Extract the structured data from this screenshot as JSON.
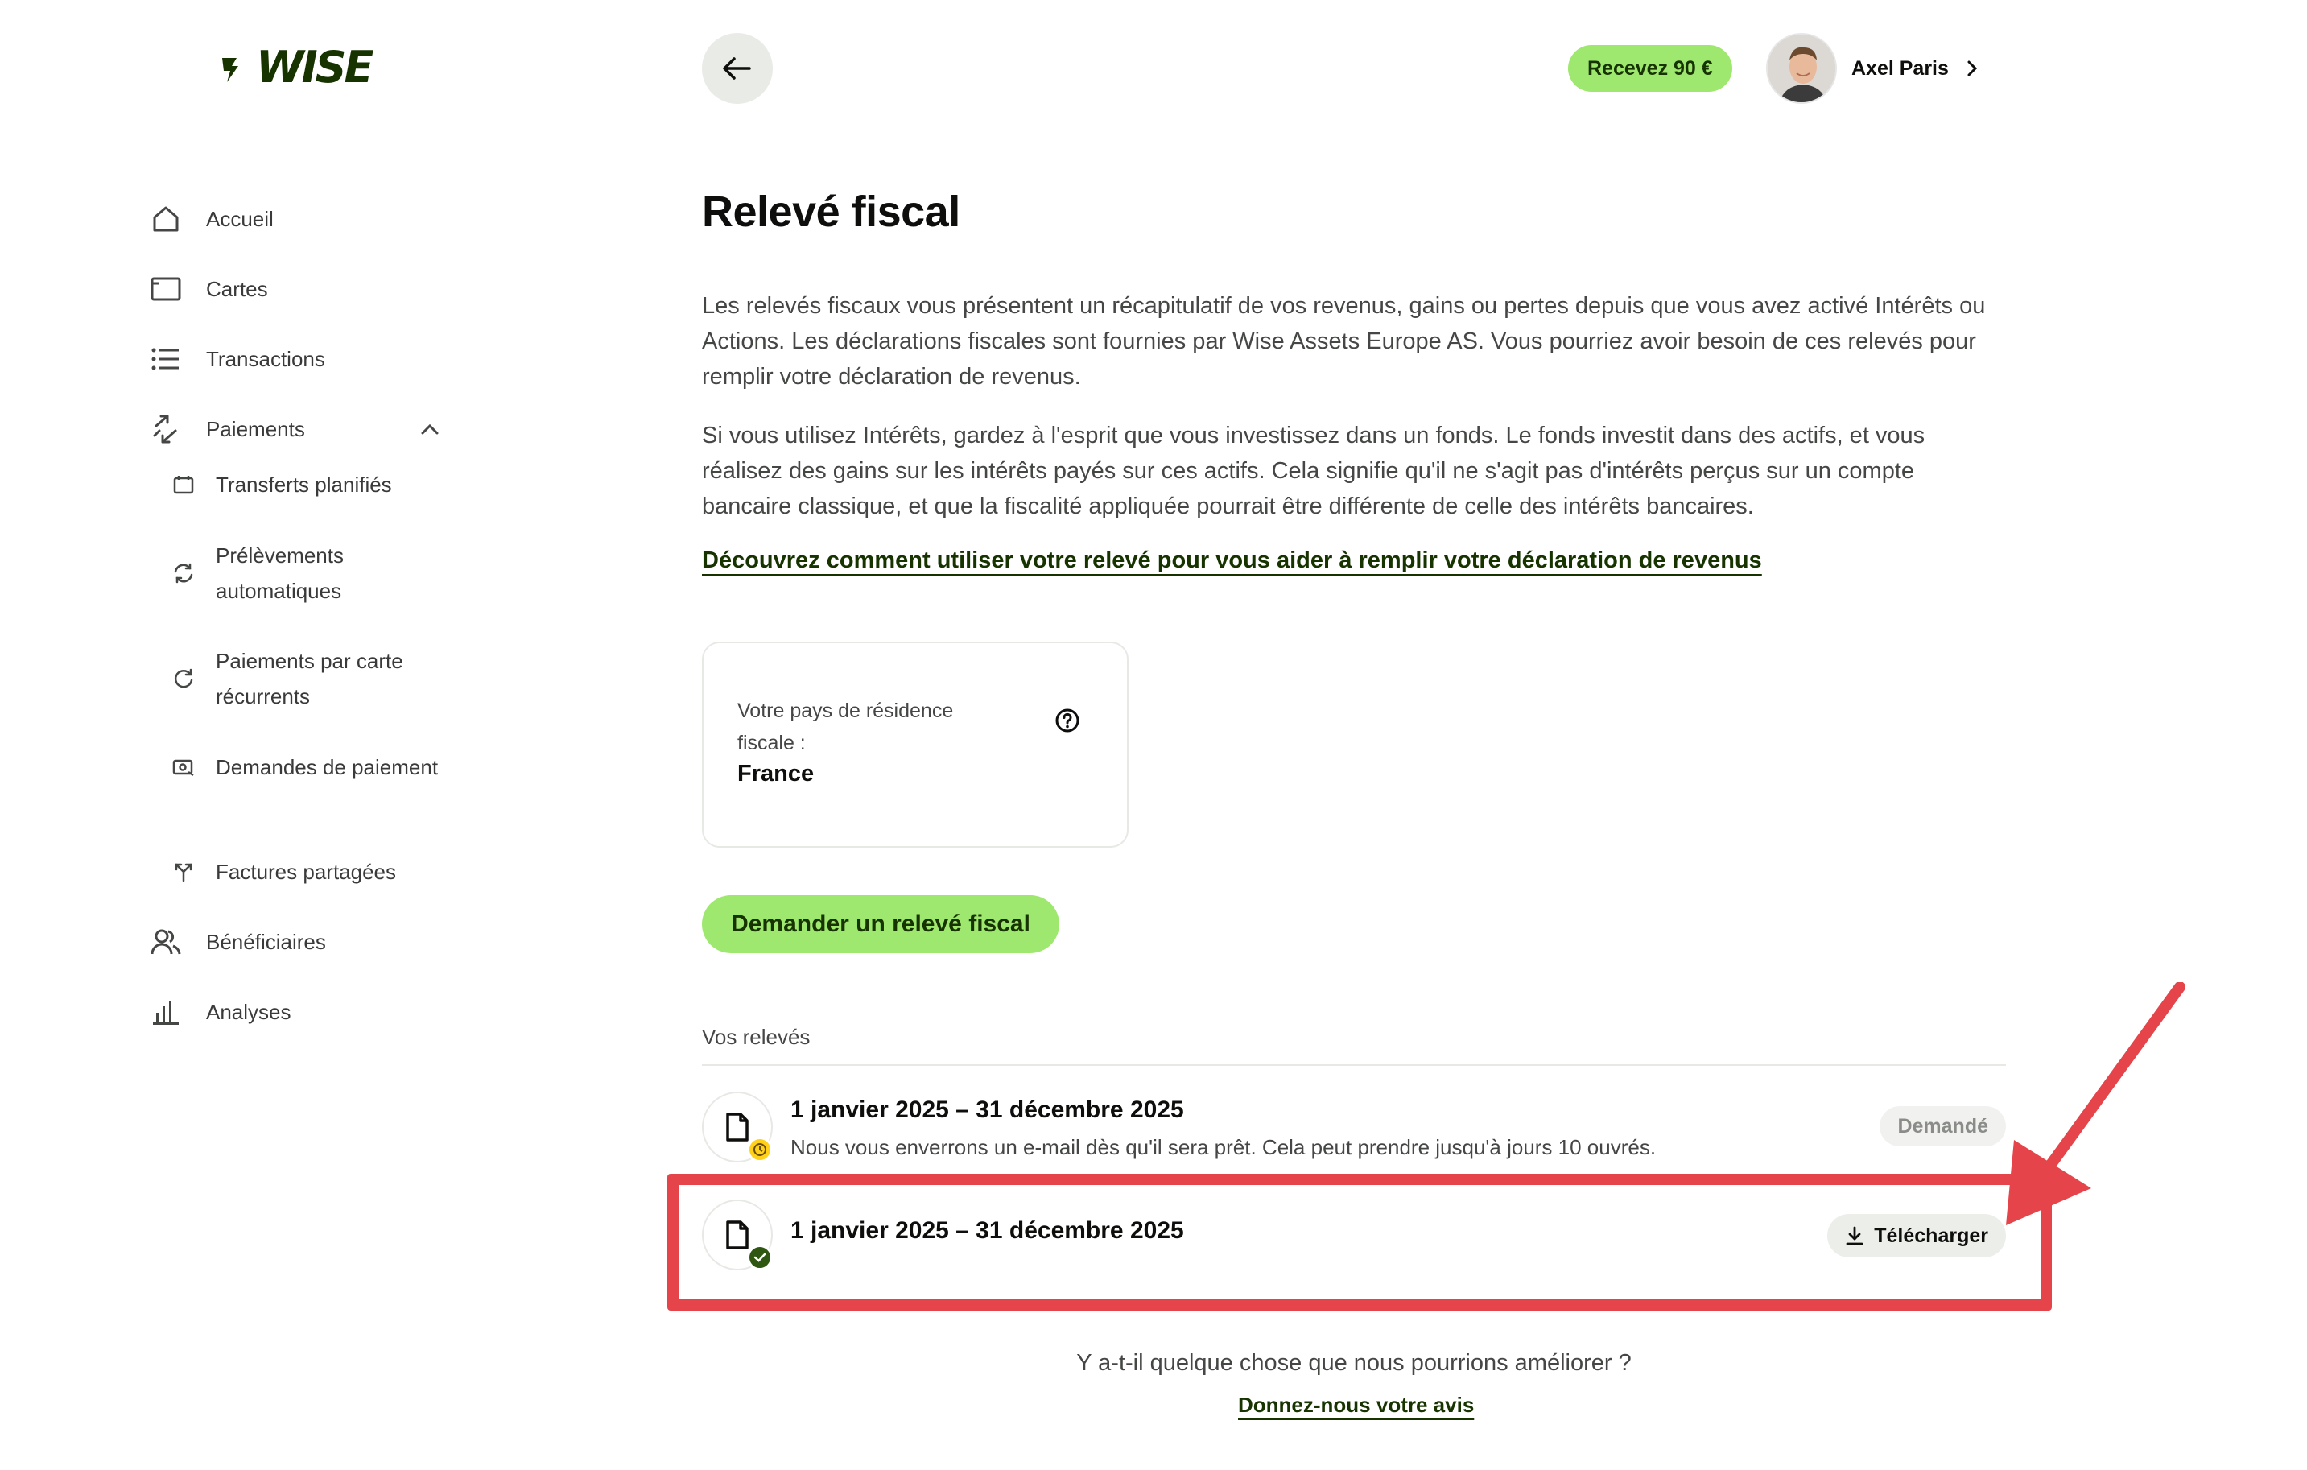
{
  "brand": {
    "name": "WISE",
    "accent": "#9fe870",
    "dark": "#163300",
    "highlight": "#e5454a"
  },
  "sidebar": {
    "items": [
      {
        "label": "Accueil",
        "icon": "home-icon"
      },
      {
        "label": "Cartes",
        "icon": "card-icon"
      },
      {
        "label": "Transactions",
        "icon": "list-icon"
      },
      {
        "label": "Paiements",
        "icon": "payments-icon",
        "expanded": true
      },
      {
        "label": "Bénéficiaires",
        "icon": "recipients-icon"
      },
      {
        "label": "Analyses",
        "icon": "bar-chart-icon"
      }
    ],
    "sub_items": [
      {
        "label": "Transferts planifiés",
        "icon": "calendar-icon"
      },
      {
        "label": "Prélèvements automatiques",
        "icon": "sync-icon"
      },
      {
        "label": "Paiements par carte récurrents",
        "icon": "refresh-icon"
      },
      {
        "label": "Demandes de paiement",
        "icon": "request-icon"
      },
      {
        "label": "Factures partagées",
        "icon": "split-icon"
      }
    ]
  },
  "header": {
    "promo_label": "Recevez 90 €",
    "user_name": "Axel Paris"
  },
  "main": {
    "title": "Relevé fiscal",
    "paragraph1": "Les relevés fiscaux vous présentent un récapitulatif de vos revenus, gains ou pertes depuis que vous avez activé Intérêts ou Actions. Les déclarations fiscales sont fournies par Wise Assets Europe AS. Vous pourriez avoir besoin de ces relevés pour remplir votre déclaration de revenus.",
    "paragraph2": "Si vous utilisez Intérêts, gardez à l'esprit que vous investissez dans un fonds. Le fonds investit dans des actifs, et vous réalisez des gains sur les intérêts payés sur ces actifs. Cela signifie qu'il ne s'agit pas d'intérêts perçus sur un compte bancaire classique, et que la fiscalité appliquée pourrait être différente de celle des intérêts bancaires.",
    "learn_link": "Découvrez comment utiliser votre relevé pour vous aider à remplir votre déclaration de revenus",
    "residence": {
      "label": "Votre pays de résidence fiscale :",
      "value": "France"
    },
    "request_button": "Demander un relevé fiscal",
    "statements_label": "Vos relevés",
    "statements": [
      {
        "period": "1 janvier 2025 – 31 décembre 2025",
        "note": "Nous vous enverrons un e-mail dès qu'il sera prêt. Cela peut prendre jusqu'à jours 10 ouvrés.",
        "status": "Demandé",
        "badge": "pending"
      },
      {
        "period": "1 janvier 2025 – 31 décembre 2025",
        "action": "Télécharger",
        "badge": "ready"
      }
    ],
    "feedback_question": "Y a-t-il quelque chose que nous pourrions améliorer ?",
    "feedback_link": "Donnez-nous votre avis"
  }
}
